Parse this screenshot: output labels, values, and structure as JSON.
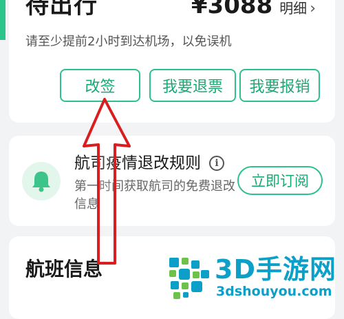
{
  "status_card": {
    "title": "待出行",
    "price": "¥3088",
    "detail_label": "明细",
    "detail_chevron": "›",
    "hint": "请至少提前2小时到达机场，以免误机",
    "buttons": {
      "change": "改签",
      "refund": "我要退票",
      "reimburse": "我要报销"
    }
  },
  "notice_card": {
    "icon": "bell-icon",
    "title": "航司疫情退改规则",
    "info_icon": "i",
    "description": "第一时间获取航司的免费退改信息",
    "subscribe_label": "立即订阅"
  },
  "flight_card": {
    "title": "航班信息"
  },
  "annotation": {
    "arrow_color": "#d81e1e"
  },
  "watermark": {
    "name": "3D手游网",
    "url": "3dshouyou.com"
  },
  "colors": {
    "accent": "#2bc48a",
    "button_text": "#1aa874",
    "background": "#f2f3f5",
    "watermark": "#0c9fc7"
  }
}
